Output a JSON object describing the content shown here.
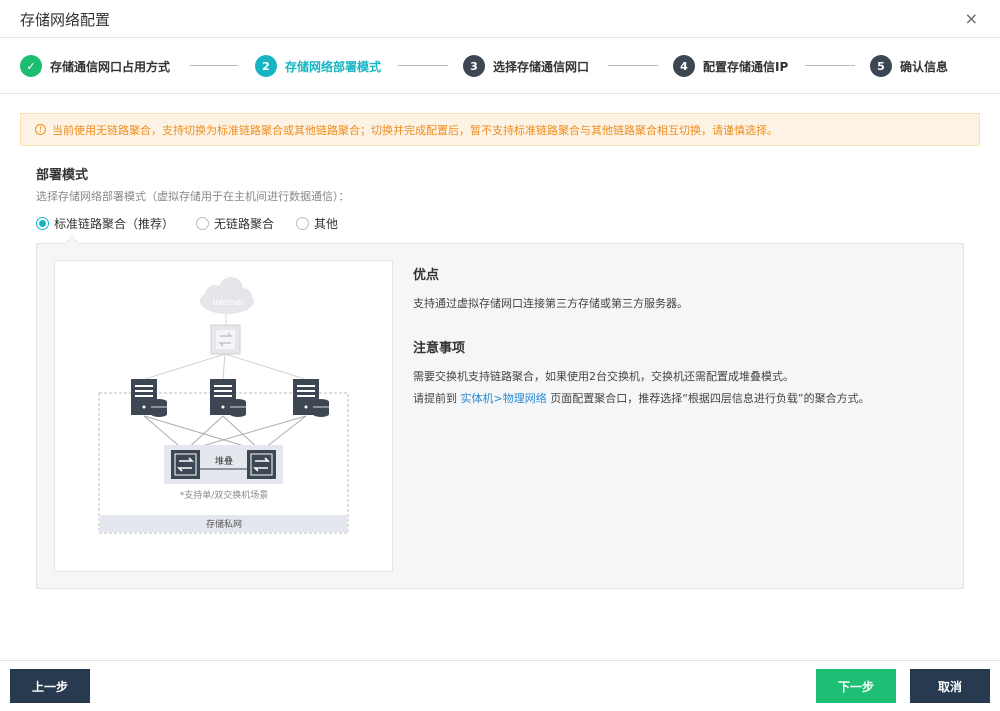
{
  "dialog": {
    "title": "存储网络配置",
    "close_glyph": "×"
  },
  "steps": [
    {
      "num": "✓",
      "label": "存储通信网口占用方式",
      "state": "done"
    },
    {
      "num": "2",
      "label": "存储网络部署模式",
      "state": "active"
    },
    {
      "num": "3",
      "label": "选择存储通信网口",
      "state": "pending"
    },
    {
      "num": "4",
      "label": "配置存储通信IP",
      "state": "pending"
    },
    {
      "num": "5",
      "label": "确认信息",
      "state": "pending"
    }
  ],
  "warning": {
    "icon": "info-icon",
    "glyph": "!",
    "text": "当前使用无链路聚合，支持切换为标准链路聚合或其他链路聚合；切换并完成配置后，暂不支持标准链路聚合与其他链路聚合相互切换，请谨慎选择。"
  },
  "deploy": {
    "title": "部署模式",
    "desc": "选择存储网络部署模式（虚拟存储用于在主机间进行数据通信）：",
    "options": [
      {
        "label": "标准链路聚合（推荐）",
        "checked": true
      },
      {
        "label": "无链路聚合",
        "checked": false
      },
      {
        "label": "其他",
        "checked": false
      }
    ]
  },
  "diagram": {
    "internet_label": "Internet",
    "stack_label": "堆叠",
    "switch_note": "*支持单/双交换机场景",
    "private_net_label": "存储私网"
  },
  "info": {
    "adv_title": "优点",
    "adv_text": "支持通过虚拟存储网口连接第三方存储或第三方服务器。",
    "note_title": "注意事项",
    "note_line1": "需要交换机支持链路聚合，如果使用2台交换机，交换机还需配置成堆叠模式。",
    "note_line2_pre": "请提前到",
    "note_link": "实体机>物理网络",
    "note_line2_post": "页面配置聚合口，推荐选择“根据四层信息进行负载”的聚合方式。"
  },
  "footer": {
    "prev": "上一步",
    "next": "下一步",
    "cancel": "取消"
  },
  "colors": {
    "accent": "#17b5c3",
    "done": "#1cbd6f",
    "warning": "#ef8d1d",
    "dark_button": "#273a4f",
    "primary_button": "#1dbf75"
  }
}
